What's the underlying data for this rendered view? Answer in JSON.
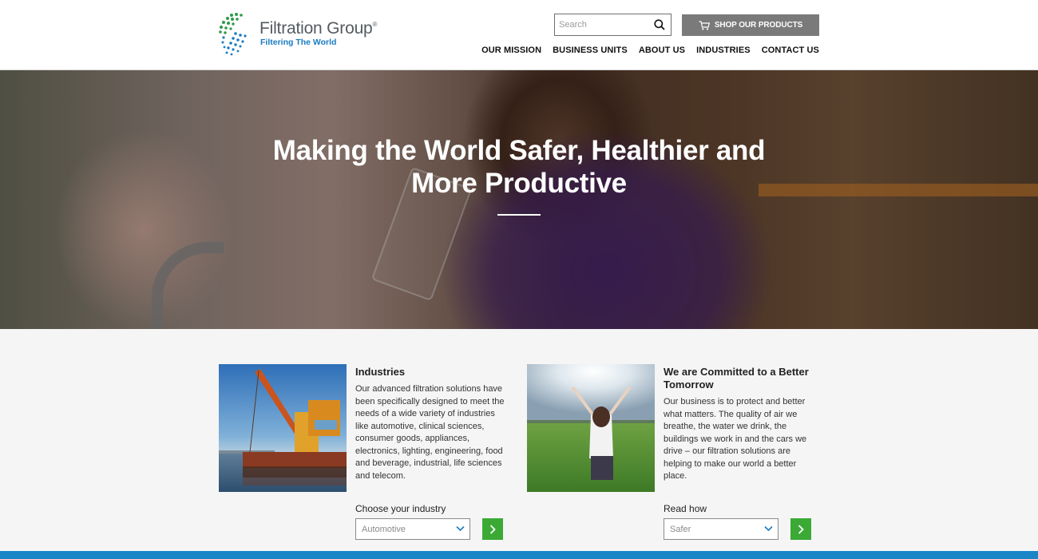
{
  "header": {
    "logo": {
      "name": "Filtration Group",
      "registered": "®",
      "tagline": "Filtering The World"
    },
    "search": {
      "placeholder": "Search",
      "icon": "search-icon"
    },
    "shop_button": {
      "label": "SHOP OUR PRODUCTS",
      "icon": "cart-icon"
    },
    "nav": [
      {
        "label": "OUR MISSION"
      },
      {
        "label": "BUSINESS UNITS"
      },
      {
        "label": "ABOUT US"
      },
      {
        "label": "INDUSTRIES"
      },
      {
        "label": "CONTACT US"
      }
    ]
  },
  "hero": {
    "title_line1": "Making the World Safer, Healthier and",
    "title_line2": "More Productive"
  },
  "cards": [
    {
      "title": "Industries",
      "text": "Our advanced filtration solutions have been specifically designed to meet the needs of a wide variety of industries like automotive, clinical sciences, consumer goods, appliances, electronics, lighting, engineering, food and beverage, industrial, life sciences and telecom.",
      "select_label": "Choose your industry",
      "select_value": "Automotive"
    },
    {
      "title": "We are Committed to a Better Tomorrow",
      "text": "Our business is to protect and better what matters. The quality of air we breathe, the water we drink, the buildings we work in and the cars we drive – our filtration solutions are helping to make our world a better place.",
      "select_label": "Read how",
      "select_value": "Safer"
    }
  ],
  "colors": {
    "brand_blue": "#1a7bc2",
    "brand_green": "#3aaa35",
    "shop_button": "#7a7a7a",
    "footer_bar": "#1a86c8"
  }
}
